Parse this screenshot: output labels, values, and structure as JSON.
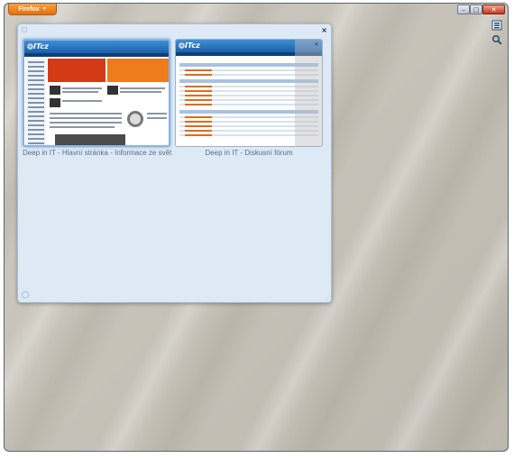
{
  "window": {
    "app_menu_label": "Firefox",
    "caption_buttons": {
      "minimize": "–",
      "maximize": "□",
      "close": "✕"
    }
  },
  "side_tools": [
    {
      "name": "panorama-icon"
    },
    {
      "name": "search-icon"
    }
  ],
  "tab_group": {
    "close_symbol": "×",
    "tabs": [
      {
        "label": "Deep in IT - Hlavní stránka - Informace ze svět",
        "thumb_logo": "ITcz"
      },
      {
        "label": "Deep in IT - Diskusní fórum",
        "thumb_logo": "ITcz"
      }
    ]
  },
  "colors": {
    "accent_orange": "#e46f10",
    "group_background": "#dde9f5",
    "selected_tab_border": "#8fb3da"
  }
}
